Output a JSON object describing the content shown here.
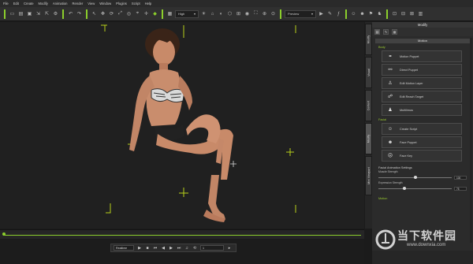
{
  "menu": [
    "File",
    "Edit",
    "Create",
    "Modify",
    "Animation",
    "Render",
    "View",
    "Window",
    "Plugins",
    "Script",
    "Help"
  ],
  "toolbar": {
    "quality_value": "High",
    "preview_value": "Preview"
  },
  "side_tabs": [
    "Modify",
    "Visual",
    "Content",
    "Modify",
    "Mini Viewport"
  ],
  "panel": {
    "title": "Modify",
    "section": "Motion",
    "body_group": "Body",
    "body_buttons": [
      "Motion Puppet",
      "Direct Puppet",
      "Edit Motion Layer",
      "Edit Reach Target",
      "Multilimus"
    ],
    "face_group": "Facial",
    "face_buttons": [
      "Create Script",
      "Face Puppet",
      "Face Key"
    ],
    "settings_label": "Facial Animation Settings",
    "sliders": [
      {
        "label": "Muscle Strength",
        "value": "100",
        "fraction": 0.5
      },
      {
        "label": "Expression Strength",
        "value": "75",
        "fraction": 0.35
      }
    ],
    "footer_label": "Motion"
  },
  "playback": {
    "mode": "Realtime",
    "frame": "1"
  },
  "watermark": {
    "brand": "当下软件园",
    "url": "www.downxia.com"
  },
  "colors": {
    "accent": "#8ccf2c",
    "marker": "#b8d11a"
  }
}
